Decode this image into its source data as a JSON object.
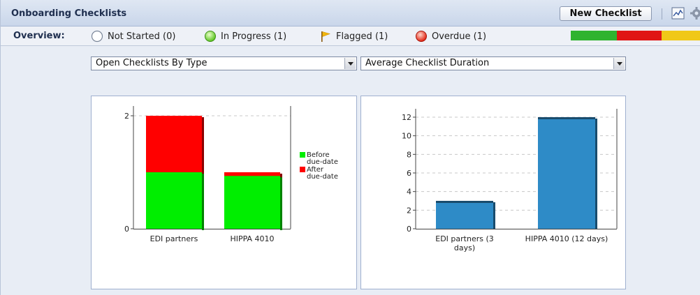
{
  "header": {
    "title": "Onboarding Checklists",
    "new_button": "New Checklist"
  },
  "overview": {
    "label": "Overview:",
    "items": [
      {
        "label": "Not Started (0)",
        "icon": "empty-circle-icon"
      },
      {
        "label": "In Progress (1)",
        "icon": "green-circle-icon"
      },
      {
        "label": "Flagged (1)",
        "icon": "flag-icon"
      },
      {
        "label": "Overdue (1)",
        "icon": "red-circle-icon"
      }
    ],
    "status_colors": [
      "#2fb32f",
      "#e01414",
      "#f0c818"
    ]
  },
  "selects": {
    "left": "Open Checklists By Type",
    "right": "Average Checklist Duration"
  },
  "chart_data": [
    {
      "type": "bar",
      "stacked": true,
      "categories": [
        "EDI partners",
        "HIPPA 4010"
      ],
      "series": [
        {
          "name": "Before due-date",
          "values": [
            1,
            1
          ],
          "color": "#00ee00"
        },
        {
          "name": "After due-date",
          "values": [
            1,
            0.02
          ],
          "color": "#ff0000"
        }
      ],
      "ylim": [
        0,
        2
      ],
      "yticks": [
        0,
        2
      ],
      "grid": true,
      "legend": "right"
    },
    {
      "type": "bar",
      "categories": [
        "EDI partners (3 days)",
        "HIPPA 4010 (12 days)"
      ],
      "values": [
        3,
        12
      ],
      "color": "#2e8bc7",
      "ylim": [
        0,
        12
      ],
      "yticks": [
        0,
        2,
        4,
        6,
        8,
        10,
        12
      ],
      "grid": true
    }
  ]
}
